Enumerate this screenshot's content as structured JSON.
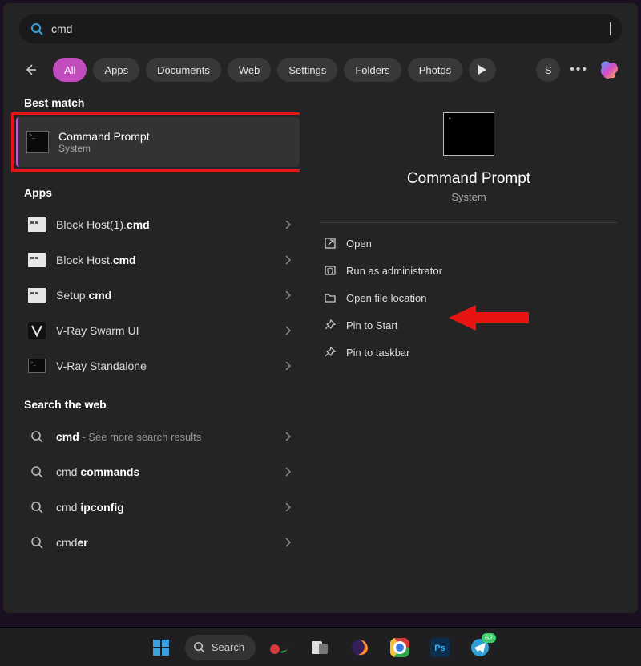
{
  "search": {
    "value": "cmd"
  },
  "filters": {
    "items": [
      "All",
      "Apps",
      "Documents",
      "Web",
      "Settings",
      "Folders",
      "Photos"
    ],
    "active_index": 0,
    "user_initial": "S"
  },
  "sections": {
    "best_match": "Best match",
    "apps": "Apps",
    "search_web": "Search the web"
  },
  "best": {
    "title": "Command Prompt",
    "subtitle": "System"
  },
  "app_results": [
    {
      "prefix": "Block Host(1).",
      "bold": "cmd"
    },
    {
      "prefix": "Block Host.",
      "bold": "cmd"
    },
    {
      "prefix": "Setup.",
      "bold": "cmd"
    },
    {
      "prefix": "V-Ray Swarm UI",
      "bold": ""
    },
    {
      "prefix": "V-Ray Standalone",
      "bold": ""
    }
  ],
  "web_results": [
    {
      "bold": "cmd",
      "rest": "",
      "muted": " - See more search results"
    },
    {
      "bold": "",
      "rest": "cmd ",
      "bold2": "commands"
    },
    {
      "bold": "",
      "rest": "cmd ",
      "bold2": "ipconfig"
    },
    {
      "bold": "",
      "rest": "cmd",
      "bold2": "er"
    }
  ],
  "preview": {
    "title": "Command Prompt",
    "subtitle": "System"
  },
  "actions": [
    {
      "icon": "open",
      "label": "Open"
    },
    {
      "icon": "shield",
      "label": "Run as administrator"
    },
    {
      "icon": "folder",
      "label": "Open file location"
    },
    {
      "icon": "pin",
      "label": "Pin to Start"
    },
    {
      "icon": "pin",
      "label": "Pin to taskbar"
    }
  ],
  "taskbar": {
    "search_label": "Search",
    "telegram_badge": "62"
  }
}
